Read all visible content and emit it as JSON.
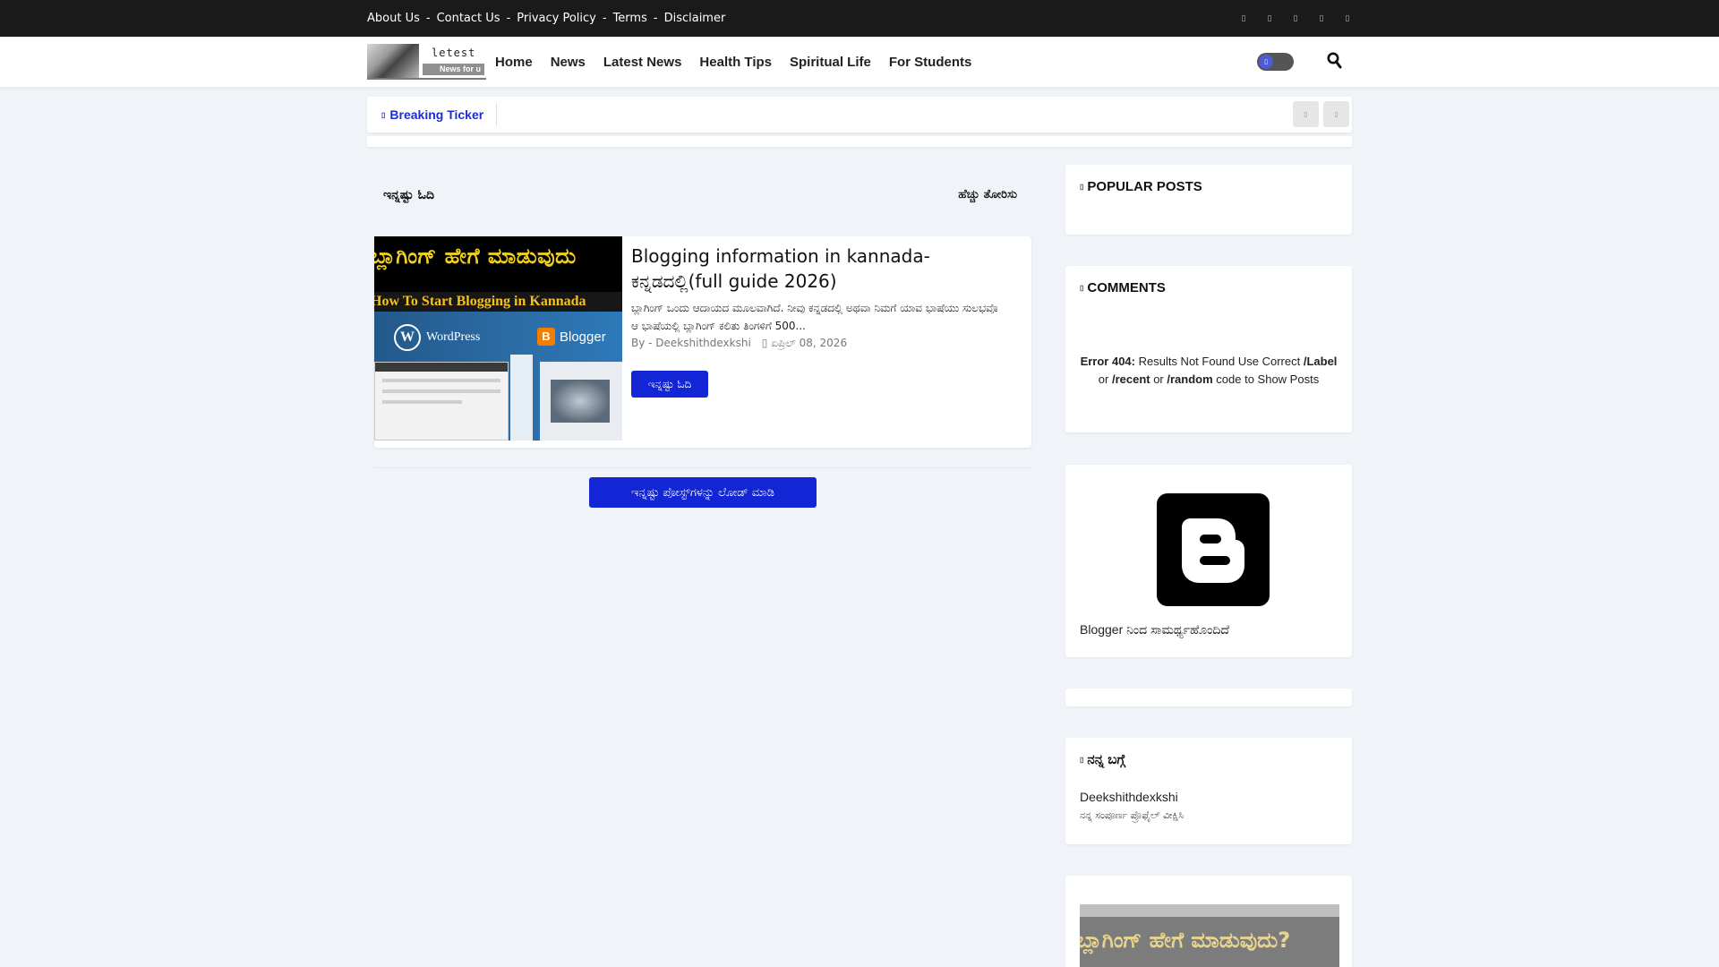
{
  "topbar": {
    "links": [
      "About Us",
      "Contact Us",
      "Privacy Policy",
      "Terms",
      "Disclaimer"
    ],
    "separator": "-",
    "social_icons": [
      "facebook-icon",
      "twitter-icon",
      "instagram-icon",
      "youtube-icon",
      "telegram-icon"
    ],
    "social_glyph": "▯"
  },
  "header": {
    "logo_line1": "letest",
    "logo_line2": "News for u",
    "nav": [
      "Home",
      "News",
      "Latest News",
      "Health Tips",
      "Spiritual Life",
      "For Students"
    ],
    "toggle_glyph": "▯"
  },
  "ticker": {
    "label": "Breaking Ticker",
    "label_glyph": "▯",
    "arrow_glyph": "▯"
  },
  "main": {
    "section_left": "ಇನ್ನಷ್ಟು ಓದಿ",
    "section_right": "ಹೆಚ್ಚು ತೋರಿಸು",
    "post": {
      "thumb_kannada": "ಬ್ಲಾಗಿಂಗ್ ಹೇಗೆ ಮಾಡುವುದು",
      "thumb_english": "How To Start Blogging in Kannada",
      "thumb_wp": "WordPress",
      "thumb_blogger": "Blogger",
      "title": "Blogging information in kannada- ಕನ್ನಡದಲ್ಲಿ(full guide 2026)",
      "excerpt": "ಬ್ಲಾಗಿಂಗ್ ಒಂದು ಆದಾಯದ ಮೂಲವಾಗಿದೆ. ನೀವು ಕನ್ನಡದಲ್ಲಿ ಅಥವಾ ನಿಮಗೆ ಯಾವ ಭಾಷೆಯು ಸುಲಭವೊ ಆ ಭಾಷೆಯಲ್ಲಿ ಬ್ಲಾಗಿಂಗ್ ಕಲಿತು ತಿಂಗಳಿಗೆ 500...",
      "author": "By - Deekshithdexkshi",
      "date": "▯ ಏಪ್ರಿಲ್ 08, 2026",
      "read_more": "ಇನ್ನಷ್ಟು ಓದಿ"
    },
    "load_more": "ಇನ್ನಷ್ಟು ಪೋಸ್ಟ್‌ಗಳನ್ನು ಲೋಡ್ ಮಾಡಿ"
  },
  "sidebar": {
    "title_glyph": "▯",
    "popular_title": "POPULAR POSTS",
    "comments_title": "COMMENTS",
    "error_bold": "Error 404:",
    "error_text1": " Results Not Found Use Correct ",
    "error_label": "/Label",
    "error_text2": "or ",
    "error_recent": "/recent",
    "error_or": " or ",
    "error_random": "/random",
    "error_text3": " code to Show Posts",
    "powered_by": "Blogger ನಿಂದ ಸಾಮರ್ಥ್ಯಹೊಂದಿದೆ",
    "about_title": "ನನ್ನ ಬಗ್ಗೆ",
    "about_name": "Deekshithdexkshi",
    "about_sub": "ನನ್ನ ಸಂಪೂರ್ಣ ಪ್ರೊಫೈಲ್ ವೀಕ್ಷಿಸಿ",
    "bottom_kannada": "ಬ್ಲಾಗಿಂಗ್ ಹೇಗೆ ಮಾಡುವುದು?"
  },
  "colors": {
    "accent": "#1326d6",
    "topbar": "#1a1a1a",
    "background": "#f0f4f8"
  }
}
